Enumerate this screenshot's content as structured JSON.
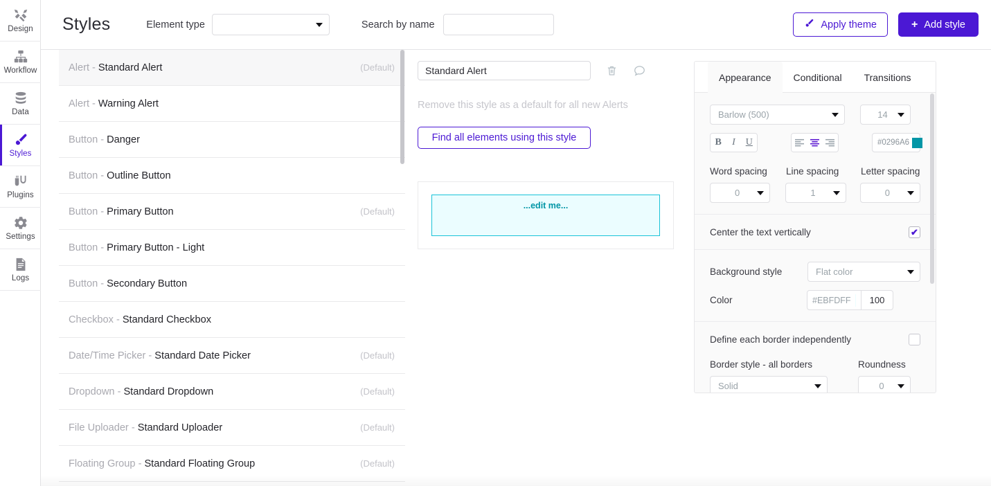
{
  "sidebar": {
    "items": [
      {
        "label": "Design",
        "icon": "design-icon",
        "active": false
      },
      {
        "label": "Workflow",
        "icon": "workflow-icon",
        "active": false
      },
      {
        "label": "Data",
        "icon": "data-icon",
        "active": false
      },
      {
        "label": "Styles",
        "icon": "styles-icon",
        "active": true
      },
      {
        "label": "Plugins",
        "icon": "plugins-icon",
        "active": false
      },
      {
        "label": "Settings",
        "icon": "settings-icon",
        "active": false
      },
      {
        "label": "Logs",
        "icon": "logs-icon",
        "active": false
      }
    ]
  },
  "header": {
    "title": "Styles",
    "element_type_label": "Element type",
    "element_type_value": "",
    "search_label": "Search by name",
    "search_value": "",
    "search_placeholder": "",
    "apply_theme_label": "Apply theme",
    "apply_theme_icon": "paintbrush-icon",
    "add_style_label": "Add style",
    "add_style_icon": "plus-icon",
    "accent_color": "#4B18D4"
  },
  "style_list": {
    "rows": [
      {
        "type": "Alert -",
        "name": "Standard Alert",
        "default": "(Default)",
        "selected": true
      },
      {
        "type": "Alert -",
        "name": "Warning Alert",
        "default": "",
        "selected": false
      },
      {
        "type": "Button -",
        "name": "Danger",
        "default": "",
        "selected": false
      },
      {
        "type": "Button -",
        "name": "Outline Button",
        "default": "",
        "selected": false
      },
      {
        "type": "Button -",
        "name": "Primary Button",
        "default": "(Default)",
        "selected": false
      },
      {
        "type": "Button -",
        "name": "Primary Button - Light",
        "default": "",
        "selected": false
      },
      {
        "type": "Button -",
        "name": "Secondary Button",
        "default": "",
        "selected": false
      },
      {
        "type": "Checkbox -",
        "name": "Standard Checkbox",
        "default": "",
        "selected": false
      },
      {
        "type": "Date/Time Picker -",
        "name": "Standard Date Picker",
        "default": "(Default)",
        "selected": false
      },
      {
        "type": "Dropdown -",
        "name": "Standard Dropdown",
        "default": "(Default)",
        "selected": false
      },
      {
        "type": "File Uploader -",
        "name": "Standard Uploader",
        "default": "(Default)",
        "selected": false
      },
      {
        "type": "Floating Group -",
        "name": "Standard Floating Group",
        "default": "(Default)",
        "selected": false
      }
    ]
  },
  "detail": {
    "style_name_value": "Standard Alert",
    "style_name_placeholder": "",
    "delete_icon": "trash-icon",
    "comment_icon": "comment-icon",
    "default_note": "Remove this style as a default for all new Alerts",
    "find_elements_label": "Find all elements using this style",
    "preview": {
      "text": "...edit me...",
      "background": "#EBFDFF",
      "border_color": "#18C2D8",
      "text_color": "#0296A6"
    }
  },
  "properties": {
    "tabs": [
      {
        "label": "Appearance",
        "active": true
      },
      {
        "label": "Conditional",
        "active": false
      },
      {
        "label": "Transitions",
        "active": false
      }
    ],
    "font": {
      "family": "Barlow (500)",
      "size": "14",
      "bold_label": "B",
      "italic_label": "I",
      "underline_label": "U",
      "align_left_icon": "align-left-icon",
      "align_center_icon": "align-center-icon",
      "align_right_icon": "align-right-icon",
      "align_active": "center",
      "color_hex": "#0296A6",
      "color_swatch": "#0296A6"
    },
    "spacing": {
      "word_label": "Word spacing",
      "word_value": "0",
      "line_label": "Line spacing",
      "line_value": "1",
      "letter_label": "Letter spacing",
      "letter_value": "0"
    },
    "center_vertically": {
      "label": "Center the text vertically",
      "checked": true,
      "tick": "✔"
    },
    "background": {
      "style_label": "Background style",
      "style_value": "Flat color",
      "color_label": "Color",
      "color_hex": "#EBFDFF",
      "color_swatch": "#EBFDFF",
      "opacity": "100"
    },
    "border": {
      "independent_label": "Define each border independently",
      "independent_checked": false,
      "style_label": "Border style - all borders",
      "style_value": "Solid",
      "roundness_label": "Roundness",
      "roundness_value": "0"
    }
  }
}
